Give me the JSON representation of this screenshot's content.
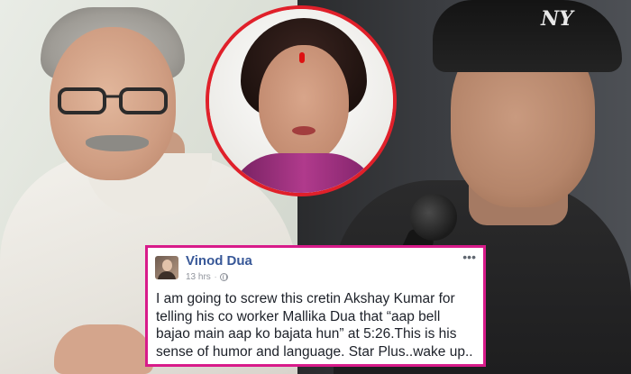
{
  "post": {
    "author": "Vinod Dua",
    "time": "13 hrs",
    "separator": "·",
    "more_label": "•••",
    "text": "I am going to screw this cretin Akshay Kumar for telling his co worker Mallika Dua that “aap bell bajao main aap ko bajata hun” at 5:26.This is his sense of humor and language. Star Plus..wake up.."
  },
  "colors": {
    "card_border": "#d81b8a",
    "inset_border": "#e0202a",
    "author_link": "#385898"
  },
  "icons": {
    "privacy": "globe-icon",
    "options": "more-icon"
  }
}
